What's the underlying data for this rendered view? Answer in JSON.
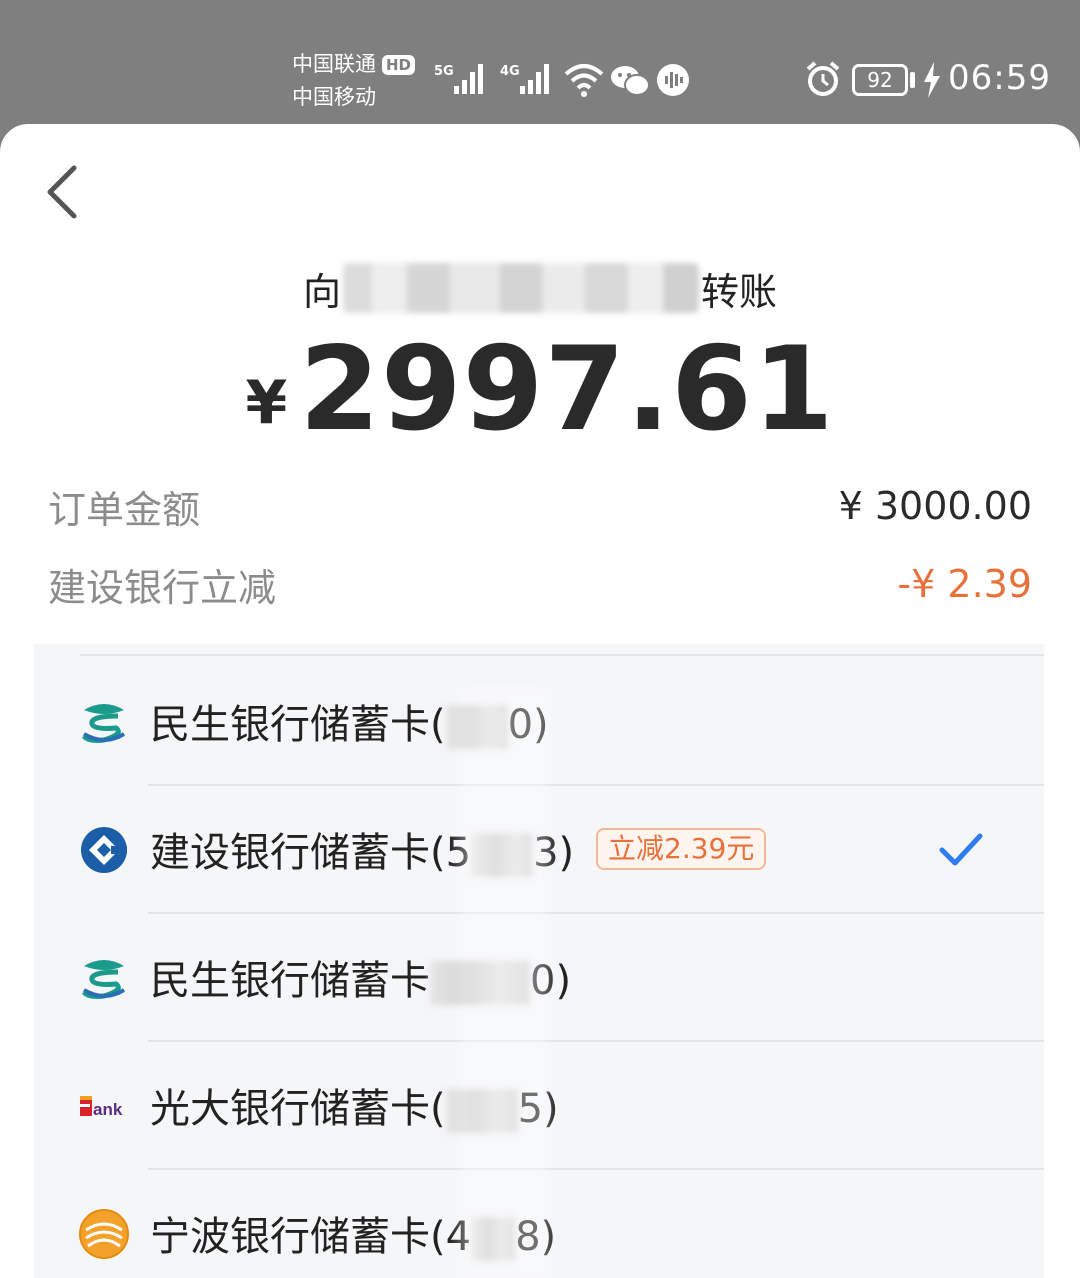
{
  "status_bar": {
    "carrier_1": "中国联通",
    "carrier_1_badge": "HD",
    "carrier_2": "中国移动",
    "signal_1_label": "5G",
    "signal_2_label": "4G",
    "battery_level": "92",
    "time": "06:59",
    "icons": [
      "wifi-icon",
      "wechat-icon",
      "voice-icon",
      "alarm-icon",
      "battery-icon",
      "charging-icon"
    ]
  },
  "header": {
    "back_icon": "chevron-left-icon",
    "recipient_prefix": "向",
    "recipient_suffix": "转账"
  },
  "payment": {
    "currency_symbol": "¥",
    "amount": "2997.61"
  },
  "details": [
    {
      "label": "订单金额",
      "value": "¥ 3000.00"
    },
    {
      "label": "建设银行立减",
      "value": "-¥ 2.39",
      "color": "#e8703a"
    }
  ],
  "cards": [
    {
      "name": "民生银行储蓄卡",
      "open": "(",
      "close": "0)",
      "icon": "cmbc-bank-icon",
      "selected": false
    },
    {
      "name": "建设银行储蓄卡",
      "open": "(5",
      "close": "3)",
      "icon": "ccb-bank-icon",
      "promo": "立减2.39元",
      "selected": true
    },
    {
      "name": "民生银行储蓄卡",
      "open": "",
      "close": "0)",
      "icon": "cmbc-bank-icon",
      "selected": false
    },
    {
      "name": "光大银行储蓄卡",
      "open": "(",
      "close": "5)",
      "icon": "ebank-icon",
      "selected": false
    },
    {
      "name": "宁波银行储蓄卡",
      "open": "(4",
      "close": "8)",
      "icon": "nbcb-bank-icon",
      "selected": false
    }
  ],
  "colors": {
    "accent_blue": "#2f7bf0",
    "discount_orange": "#e8703a",
    "status_bar_gray": "#7f7f7f"
  }
}
